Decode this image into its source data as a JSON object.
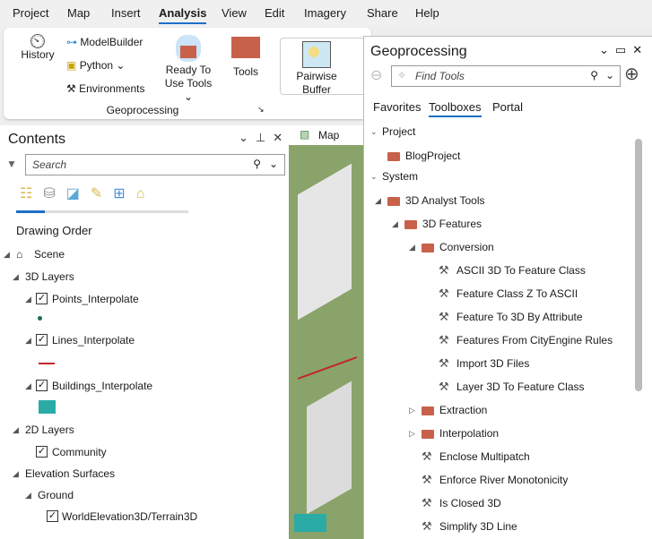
{
  "menu": [
    "Project",
    "Map",
    "Insert",
    "Analysis",
    "View",
    "Edit",
    "Imagery",
    "Share",
    "Help"
  ],
  "ribbon": {
    "history": "History",
    "modelbuilder": "ModelBuilder",
    "python": "Python",
    "environments": "Environments",
    "ready1": "Ready To",
    "ready2": "Use Tools",
    "tools": "Tools",
    "group": "Geoprocessing",
    "pair1": "Pairwise",
    "pair2": "Buffer"
  },
  "contents": {
    "title": "Contents",
    "search_placeholder": "Search",
    "heading": "Drawing Order",
    "items": [
      "Scene",
      "3D Layers",
      "Points_Interpolate",
      "Lines_Interpolate",
      "Buildings_Interpolate",
      "2D Layers",
      "Community",
      "Elevation Surfaces",
      "Ground",
      "WorldElevation3D/Terrain3D"
    ]
  },
  "map": {
    "tab": "Map"
  },
  "geo": {
    "title": "Geoprocessing",
    "search_placeholder": "Find Tools",
    "tabs": [
      "Favorites",
      "Toolboxes",
      "Portal"
    ],
    "tree": [
      "Project",
      "BlogProject",
      "System",
      "3D Analyst Tools",
      "3D Features",
      "Conversion",
      "ASCII 3D To Feature Class",
      "Feature Class Z To ASCII",
      "Feature To 3D By Attribute",
      "Features From CityEngine Rules",
      "Import 3D Files",
      "Layer 3D To Feature Class",
      "Extraction",
      "Interpolation",
      "Enclose Multipatch",
      "Enforce River Monotonicity",
      "Is Closed 3D",
      "Simplify 3D Line"
    ]
  },
  "colors": {
    "accent": "#1e6fc7",
    "toolbox": "#c8614a"
  }
}
